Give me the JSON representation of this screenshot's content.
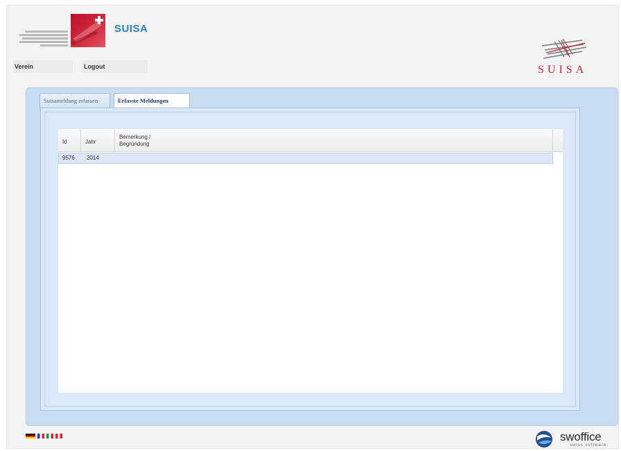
{
  "header": {
    "brand_title": "SUISA",
    "suisa_logo_text": "SUISA"
  },
  "nav": {
    "verein_label": "Verein",
    "logout_label": "Logout"
  },
  "tabs": [
    {
      "label": "Suisameldung erfassen",
      "active": false
    },
    {
      "label": "Erfasste Meldungen",
      "active": true
    }
  ],
  "grid": {
    "columns": [
      {
        "label": "Id"
      },
      {
        "label": "Jahr"
      },
      {
        "label_line1": "Bemerkung /",
        "label_line2": "Begründung"
      }
    ],
    "rows": [
      {
        "id": "9576",
        "jahr": "2014",
        "bemerkung": ""
      }
    ]
  },
  "footer": {
    "vendor_name": "swoffice",
    "vendor_tagline": "swiss software",
    "languages": [
      "de",
      "fr",
      "it",
      "en"
    ]
  },
  "colors": {
    "brand_blue": "#2a7fb5",
    "suisa_red": "#c81e2e",
    "panel_blue": "#c9ddf2"
  }
}
